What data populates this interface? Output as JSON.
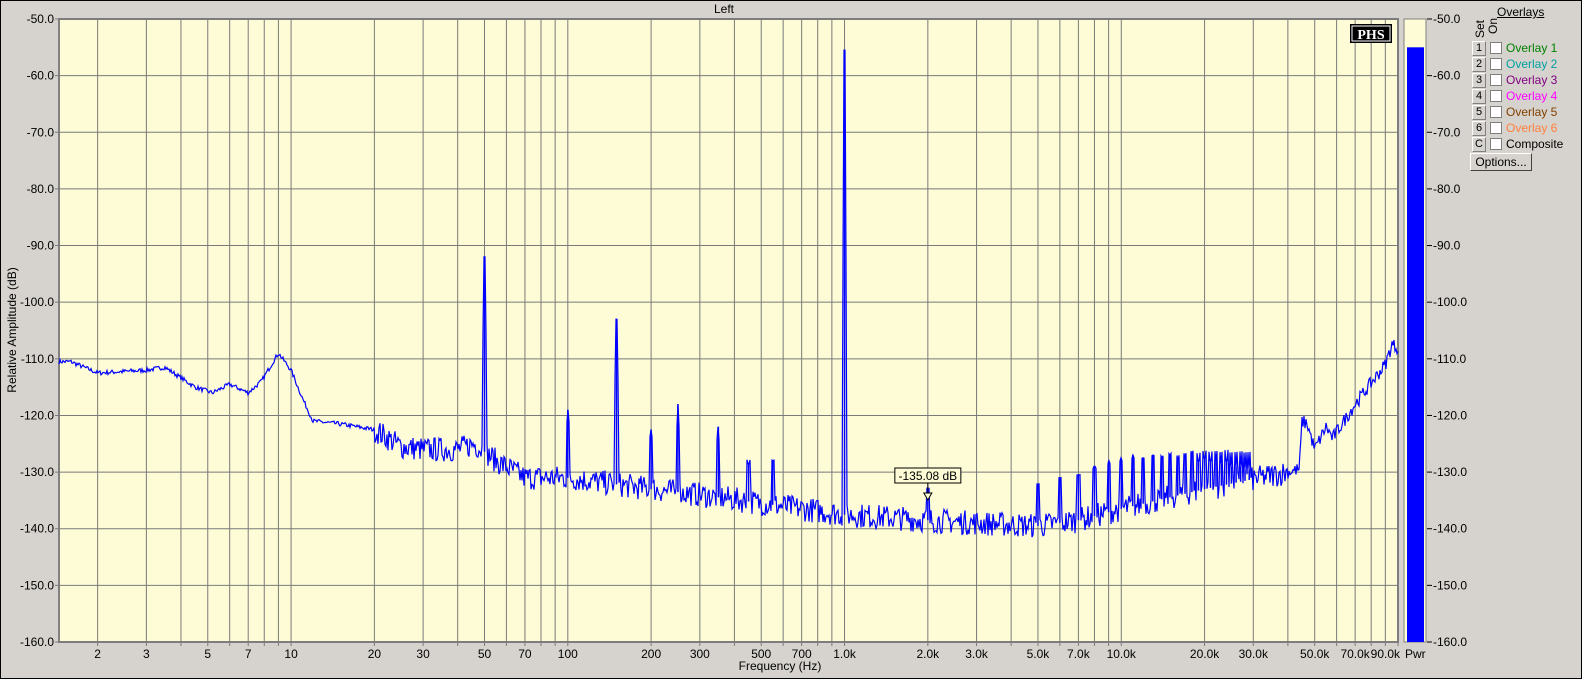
{
  "chart_data": {
    "type": "line",
    "title": "Left",
    "xlabel": "Frequency (Hz)",
    "ylabel": "Relative Amplitude (dB)",
    "xscale": "log",
    "xlim": [
      1.45,
      100000
    ],
    "ylim": [
      -160,
      -50
    ],
    "grid": true,
    "x_tick_labels": [
      {
        "v": 2,
        "t": "2"
      },
      {
        "v": 3,
        "t": "3"
      },
      {
        "v": 5,
        "t": "5"
      },
      {
        "v": 7,
        "t": "7"
      },
      {
        "v": 10,
        "t": "10"
      },
      {
        "v": 20,
        "t": "20"
      },
      {
        "v": 30,
        "t": "30"
      },
      {
        "v": 50,
        "t": "50"
      },
      {
        "v": 70,
        "t": "70"
      },
      {
        "v": 100,
        "t": "100"
      },
      {
        "v": 200,
        "t": "200"
      },
      {
        "v": 300,
        "t": "300"
      },
      {
        "v": 500,
        "t": "500"
      },
      {
        "v": 700,
        "t": "700"
      },
      {
        "v": 1000,
        "t": "1.0k"
      },
      {
        "v": 2000,
        "t": "2.0k"
      },
      {
        "v": 3000,
        "t": "3.0k"
      },
      {
        "v": 5000,
        "t": "5.0k"
      },
      {
        "v": 7000,
        "t": "7.0k"
      },
      {
        "v": 10000,
        "t": "10.0k"
      },
      {
        "v": 20000,
        "t": "20.0k"
      },
      {
        "v": 30000,
        "t": "30.0k"
      },
      {
        "v": 50000,
        "t": "50.0k"
      },
      {
        "v": 70000,
        "t": "70.0k"
      },
      {
        "v": 90000,
        "t": "90.0k"
      }
    ],
    "y_tick_labels": [
      "-50.0",
      "-60.0",
      "-70.0",
      "-80.0",
      "-90.0",
      "-100.0",
      "-110.0",
      "-120.0",
      "-130.0",
      "-140.0",
      "-150.0",
      "-160.0"
    ],
    "series": [
      {
        "name": "Left",
        "color": "#0000ff",
        "baseline": [
          [
            1.45,
            -110.5
          ],
          [
            1.6,
            -110.5
          ],
          [
            2,
            -112.5
          ],
          [
            3,
            -112
          ],
          [
            3.5,
            -111.5
          ],
          [
            4.5,
            -115
          ],
          [
            5.2,
            -116
          ],
          [
            6,
            -114.5
          ],
          [
            7,
            -116
          ],
          [
            7.8,
            -114
          ],
          [
            9,
            -109
          ],
          [
            10,
            -112
          ],
          [
            11,
            -117
          ],
          [
            12,
            -121
          ],
          [
            15,
            -121.5
          ],
          [
            20,
            -122.5
          ],
          [
            25,
            -125.5
          ],
          [
            30,
            -126
          ],
          [
            40,
            -126
          ],
          [
            46,
            -125
          ],
          [
            55,
            -128
          ],
          [
            70,
            -131
          ],
          [
            100,
            -131
          ],
          [
            200,
            -133
          ],
          [
            300,
            -134
          ],
          [
            500,
            -135.5
          ],
          [
            1000,
            -137.5
          ],
          [
            2000,
            -138.5
          ],
          [
            3000,
            -139
          ],
          [
            5000,
            -139.5
          ],
          [
            7000,
            -138.5
          ],
          [
            10000,
            -136.5
          ],
          [
            20000,
            -133
          ],
          [
            40000,
            -130
          ],
          [
            44000,
            -129.5
          ],
          [
            45000,
            -121
          ],
          [
            47000,
            -121.5
          ],
          [
            50000,
            -126
          ],
          [
            55000,
            -122
          ],
          [
            58000,
            -124
          ],
          [
            70000,
            -118
          ],
          [
            90000,
            -111
          ],
          [
            95000,
            -107.5
          ],
          [
            100000,
            -108
          ]
        ],
        "peaks": [
          [
            50,
            -92
          ],
          [
            100,
            -119
          ],
          [
            150,
            -103
          ],
          [
            200,
            -122.5
          ],
          [
            250,
            -118
          ],
          [
            350,
            -122
          ],
          [
            450,
            -128.5
          ],
          [
            550,
            -128
          ],
          [
            1000,
            -55.5
          ],
          [
            2000,
            -135
          ],
          [
            5000,
            -132.5
          ],
          [
            6000,
            -131
          ],
          [
            7000,
            -130.5
          ],
          [
            8000,
            -129
          ],
          [
            9000,
            -128
          ],
          [
            10000,
            -127.5
          ],
          [
            11000,
            -127
          ],
          [
            12000,
            -127.5
          ],
          [
            13000,
            -127
          ],
          [
            14000,
            -127.5
          ],
          [
            15000,
            -127
          ],
          [
            16000,
            -128
          ],
          [
            17000,
            -127.5
          ],
          [
            18000,
            -127
          ],
          [
            19000,
            -128
          ],
          [
            20000,
            -127.5
          ],
          [
            21000,
            -128
          ],
          [
            22000,
            -128
          ],
          [
            23000,
            -128.5
          ],
          [
            24000,
            -128
          ],
          [
            25000,
            -129
          ],
          [
            26000,
            -129
          ],
          [
            27000,
            -129
          ],
          [
            28000,
            -129.5
          ],
          [
            29000,
            -129.5
          ]
        ]
      }
    ],
    "marker": {
      "freq": 2000,
      "label": "-135.08 dB"
    },
    "power_meter": {
      "label": "Pwr",
      "value_db": -55,
      "tick_labels": [
        "-50.0",
        "-60.0",
        "-70.0",
        "-80.0",
        "-90.0",
        "-100.0",
        "-110.0",
        "-120.0",
        "-130.0",
        "-140.0",
        "-150.0",
        "-160.0"
      ],
      "color": "#0000ff"
    },
    "logo": "PHS"
  },
  "overlays": {
    "title": "Overlays",
    "col_set": "Set",
    "col_on": "On",
    "items": [
      {
        "key": "1",
        "label": "Overlay 1",
        "color": "#008000",
        "checked": false
      },
      {
        "key": "2",
        "label": "Overlay 2",
        "color": "#00a0a0",
        "checked": false
      },
      {
        "key": "3",
        "label": "Overlay 3",
        "color": "#800080",
        "checked": false
      },
      {
        "key": "4",
        "label": "Overlay 4",
        "color": "#ff00ff",
        "checked": false
      },
      {
        "key": "5",
        "label": "Overlay 5",
        "color": "#804000",
        "checked": false
      },
      {
        "key": "6",
        "label": "Overlay 6",
        "color": "#ff8040",
        "checked": false
      },
      {
        "key": "C",
        "label": "Composite",
        "color": "#000000",
        "checked": false
      }
    ],
    "options_label": "Options..."
  }
}
